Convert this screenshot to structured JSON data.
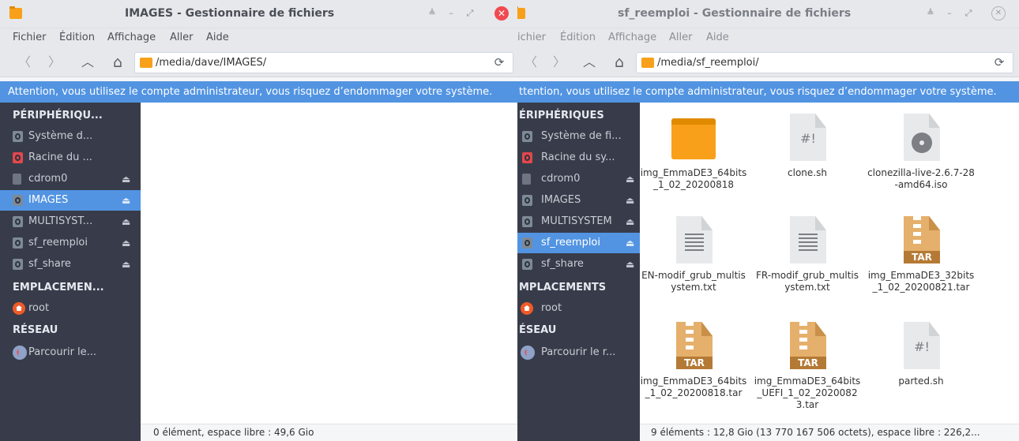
{
  "left": {
    "title": "IMAGES - Gestionnaire de fichiers",
    "menu": [
      "Fichier",
      "Édition",
      "Affichage",
      "Aller",
      "Aide"
    ],
    "path": "/media/dave/IMAGES/",
    "warning": "Attention, vous utilisez le compte administrateur, vous risquez d’endommager votre système.",
    "sidebar": {
      "devices_header": "PÉRIPHÉRIQU...",
      "devices": [
        "Système d...",
        "Racine du ...",
        "cdrom0",
        "IMAGES",
        "MULTISYST...",
        "sf_reemploi",
        "sf_share"
      ],
      "places_header": "EMPLACEMEN...",
      "places": [
        "root"
      ],
      "network_header": "RÉSEAU",
      "network": [
        "Parcourir le..."
      ]
    },
    "status": "0 élément, espace libre : 49,6 Gio"
  },
  "right": {
    "title": "sf_reemploi - Gestionnaire de fichiers",
    "menu": [
      "ichier",
      "Édition",
      "Affichage",
      "Aller",
      "Aide"
    ],
    "path": "/media/sf_reemploi/",
    "warning": "ttention, vous utilisez le compte administrateur, vous risquez d’endommager votre système.",
    "sidebar": {
      "devices_header": "ÉRIPHÉRIQUES",
      "devices": [
        "Système de fi...",
        "Racine du sy...",
        "cdrom0",
        "IMAGES",
        "MULTISYSTEM",
        "sf_reemploi",
        "sf_share"
      ],
      "places_header": "MPLACEMENTS",
      "places": [
        "root"
      ],
      "network_header": "ÉSEAU",
      "network": [
        "Parcourir le r..."
      ]
    },
    "files": [
      "img_EmmaDE3_64bits_1_02_20200818",
      "clone.sh",
      "clonezilla-live-2.6.7-28-amd64.iso",
      "EN-modif_grub_multisystem.txt",
      "FR-modif_grub_multisystem.txt",
      "img_EmmaDE3_32bits_1_02_20200821.tar",
      "img_EmmaDE3_64bits_1_02_20200818.tar",
      "img_EmmaDE3_64bits_UEFI_1_02_20200823.tar",
      "parted.sh"
    ],
    "status": "9 éléments : 12,8 Gio (13 770 167 506 octets), espace libre : 226,2..."
  },
  "icons": {
    "script_glyph": "#!",
    "tar_badge": "TAR",
    "back": "〈",
    "forward": "〉",
    "up": "︿",
    "home": "⌂",
    "reload": "⟳",
    "eject": "⏏",
    "minimize": "–",
    "maximize": "⤢",
    "restore": "≜",
    "close": "✕"
  },
  "colors": {
    "accent": "#5294e2",
    "sidebar": "#383c4a",
    "folder": "#f8a01a"
  }
}
